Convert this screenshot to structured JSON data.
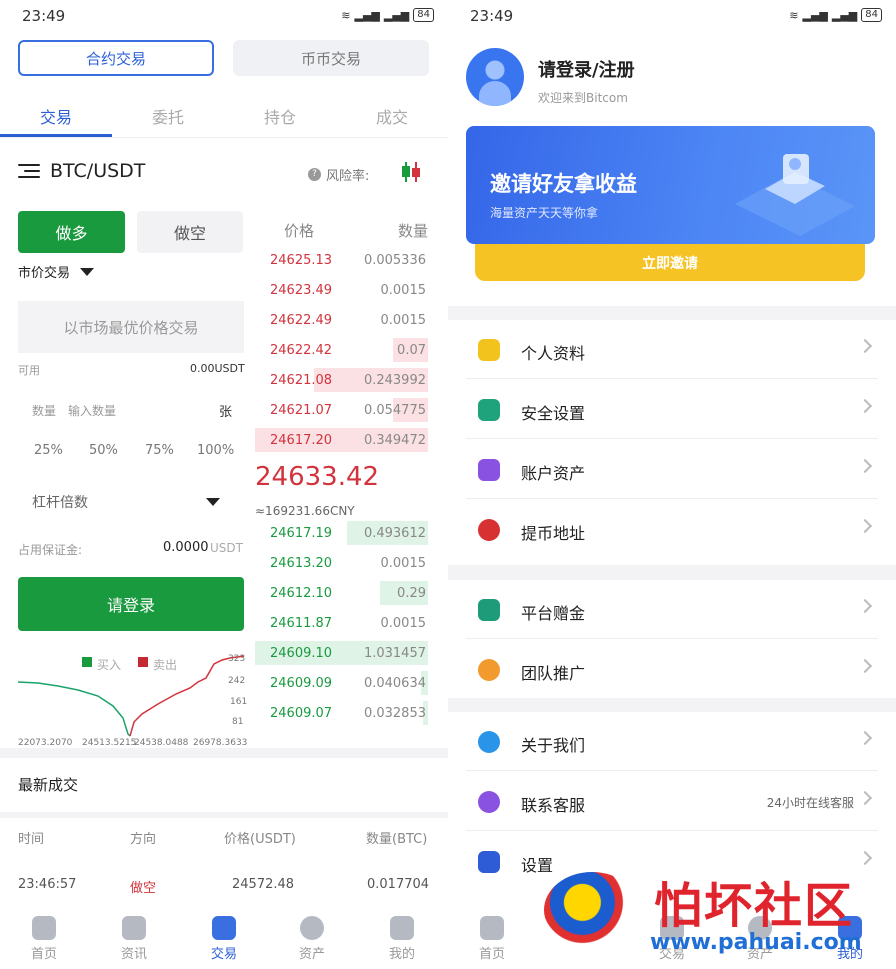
{
  "status": {
    "time": "23:49",
    "battery": "84"
  },
  "left": {
    "seg": {
      "active": "合约交易",
      "inactive": "币币交易"
    },
    "tabs": [
      "交易",
      "委托",
      "持仓",
      "成交"
    ],
    "pair": "BTC/USDT",
    "risk": "风险率:",
    "buy": "做多",
    "sell": "做空",
    "order_type": "市价交易",
    "price_placeholder": "以市场最优价格交易",
    "avail_label": "可用",
    "avail_value": "0.00USDT",
    "qty_label": "数量",
    "qty_placeholder": "输入数量",
    "qty_unit": "张",
    "pcts": [
      "25%",
      "50%",
      "75%",
      "100%"
    ],
    "leverage": "杠杆倍数",
    "margin_label": "占用保证金:",
    "margin_value": "0.0000",
    "margin_unit": "USDT",
    "login": "请登录",
    "depth": {
      "buy_label": "买入",
      "sell_label": "卖出",
      "y_ticks": [
        "323",
        "242",
        "161",
        "81"
      ],
      "x_ticks": [
        "22073.2070",
        "24513.5215",
        "24538.0488",
        "26978.3633"
      ]
    },
    "ob_head": {
      "price": "价格",
      "qty": "数量"
    },
    "asks": [
      {
        "p": "24625.13",
        "q": "0.005336",
        "d": 0.0
      },
      {
        "p": "24623.49",
        "q": "0.0015",
        "d": 0.0
      },
      {
        "p": "24622.49",
        "q": "0.0015",
        "d": 0.0
      },
      {
        "p": "24622.42",
        "q": "0.07",
        "d": 0.2
      },
      {
        "p": "24621.08",
        "q": "0.243992",
        "d": 0.66
      },
      {
        "p": "24621.07",
        "q": "0.054775",
        "d": 0.2
      },
      {
        "p": "24617.20",
        "q": "0.349472",
        "d": 1.0
      }
    ],
    "last_price": "24633.42",
    "cny": "≈169231.66CNY",
    "bids": [
      {
        "p": "24617.19",
        "q": "0.493612",
        "d": 0.47
      },
      {
        "p": "24613.20",
        "q": "0.0015",
        "d": 0.0
      },
      {
        "p": "24612.10",
        "q": "0.29",
        "d": 0.28
      },
      {
        "p": "24611.87",
        "q": "0.0015",
        "d": 0.0
      },
      {
        "p": "24609.10",
        "q": "1.031457",
        "d": 1.0
      },
      {
        "p": "24609.09",
        "q": "0.040634",
        "d": 0.04
      },
      {
        "p": "24609.07",
        "q": "0.032853",
        "d": 0.03
      }
    ],
    "latest_title": "最新成交",
    "trade_head": [
      "时间",
      "方向",
      "价格(USDT)",
      "数量(BTC)"
    ],
    "trade_row": [
      "23:46:57",
      "做空",
      "24572.48",
      "0.017704"
    ],
    "nav": [
      "首页",
      "资讯",
      "交易",
      "资产",
      "我的"
    ]
  },
  "right": {
    "user": "请登录/注册",
    "welcome": "欢迎来到Bitcom",
    "banner_title": "邀请好友拿收益",
    "banner_sub": "海量资产天天等你拿",
    "invite": "立即邀请",
    "items": [
      {
        "label": "个人资料",
        "icon": "person-icon",
        "color": "#f2c31d"
      },
      {
        "label": "安全设置",
        "icon": "shield-icon",
        "color": "#1fa37d"
      },
      {
        "label": "账户资产",
        "icon": "wallet-icon",
        "color": "#8a52e0"
      },
      {
        "label": "提币地址",
        "icon": "location-pin-icon",
        "color": "#d83131"
      },
      {
        "label": "平台赠金",
        "icon": "tether-icon",
        "color": "#1e9c7a"
      },
      {
        "label": "团队推广",
        "icon": "team-icon",
        "color": "#f29a2e"
      },
      {
        "label": "关于我们",
        "icon": "info-icon",
        "color": "#2a95e8"
      },
      {
        "label": "联系客服",
        "icon": "headset-icon",
        "color": "#8a52e0",
        "sub": "24小时在线客服"
      },
      {
        "label": "设置",
        "icon": "settings-icon",
        "color": "#2e5bd6"
      }
    ],
    "nav": [
      "首页",
      "交易",
      "资产",
      "我的"
    ]
  },
  "watermark": {
    "text": "怕坏社区",
    "url": "www.pahuai.com"
  }
}
